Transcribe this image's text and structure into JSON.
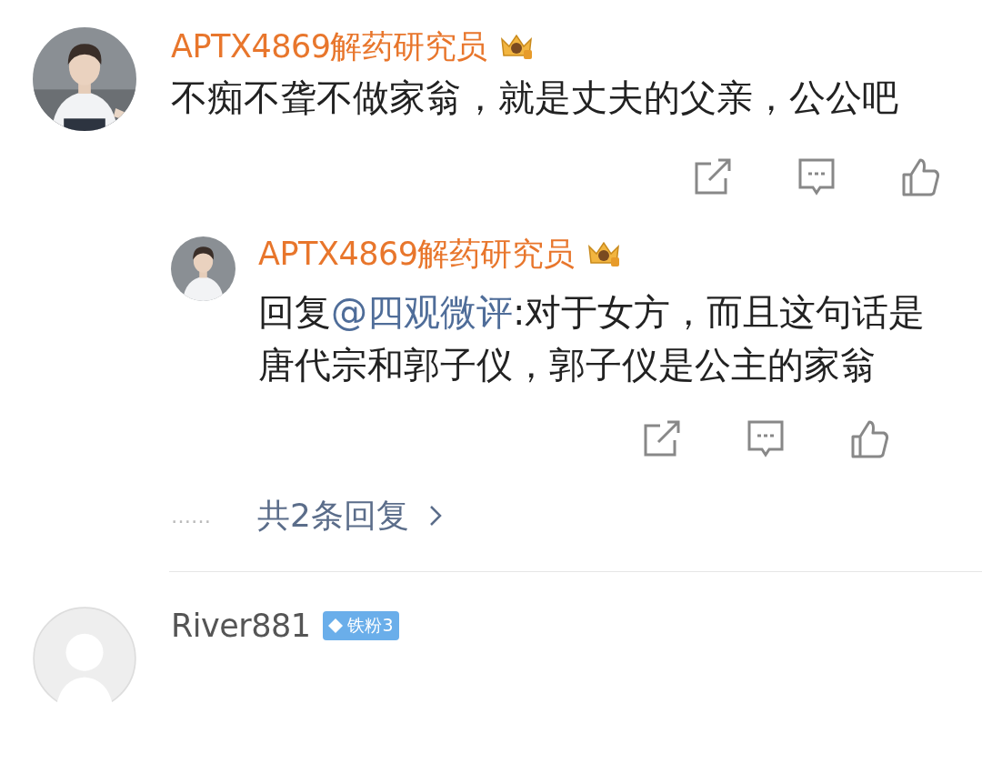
{
  "comments": [
    {
      "author": "APTX4869解药研究员",
      "badge": {
        "kind": "crown"
      },
      "text": "不痴不聋不做家翁，就是丈夫的父亲，公公吧",
      "reply": {
        "author": "APTX4869解药研究员",
        "badge": {
          "kind": "crown"
        },
        "prefix": "回复",
        "mention": "@四观微评",
        "text": ":对于女方，而且这句话是唐代宗和郭子仪，郭子仪是公主的家翁"
      },
      "more": {
        "dots": "……",
        "label": "共2条回复"
      }
    },
    {
      "author": "River881",
      "avatar": {
        "kind": "default"
      },
      "badge": {
        "kind": "fan",
        "label": "铁粉3"
      }
    }
  ]
}
